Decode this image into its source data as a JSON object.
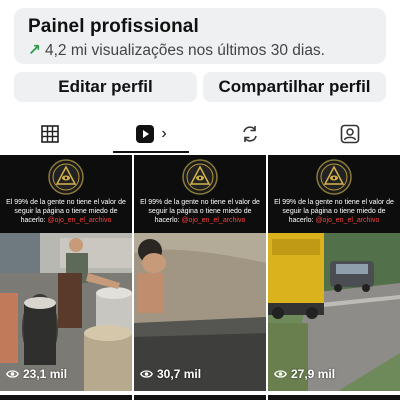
{
  "dashboard": {
    "title": "Painel profissional",
    "subtitle": "4,2 mi visualizações nos últimos 30 dias."
  },
  "actions": {
    "edit_label": "Editar perfil",
    "share_label": "Compartilhar perfil"
  },
  "tabs": [
    {
      "icon": "grid-icon"
    },
    {
      "icon": "reels-icon",
      "active": true
    },
    {
      "icon": "repost-icon"
    },
    {
      "icon": "tagged-icon"
    }
  ],
  "posts": [
    {
      "caption_main": "El 99% de la gente no tiene el valor de seguir la página o tiene miedo de hacerlo: ",
      "caption_handle": "@ojo_en_el_archivo",
      "views": "23,1 mil"
    },
    {
      "caption_main": "El 99% de la gente no tiene el valor de seguir la página o tiene miedo de hacerlo: ",
      "caption_handle": "@ojo_en_el_archivo",
      "views": "30,7 mil"
    },
    {
      "caption_main": "El 99% de la gente no tiene el valor de seguir la página o tiene miedo de hacerlo: ",
      "caption_handle": "@ojo_en_el_archivo",
      "views": "27,9 mil"
    }
  ],
  "colors": {
    "trend_arrow": "#2e9a4a",
    "handle": "#ff4040",
    "panel_bg": "#eef0f2"
  }
}
